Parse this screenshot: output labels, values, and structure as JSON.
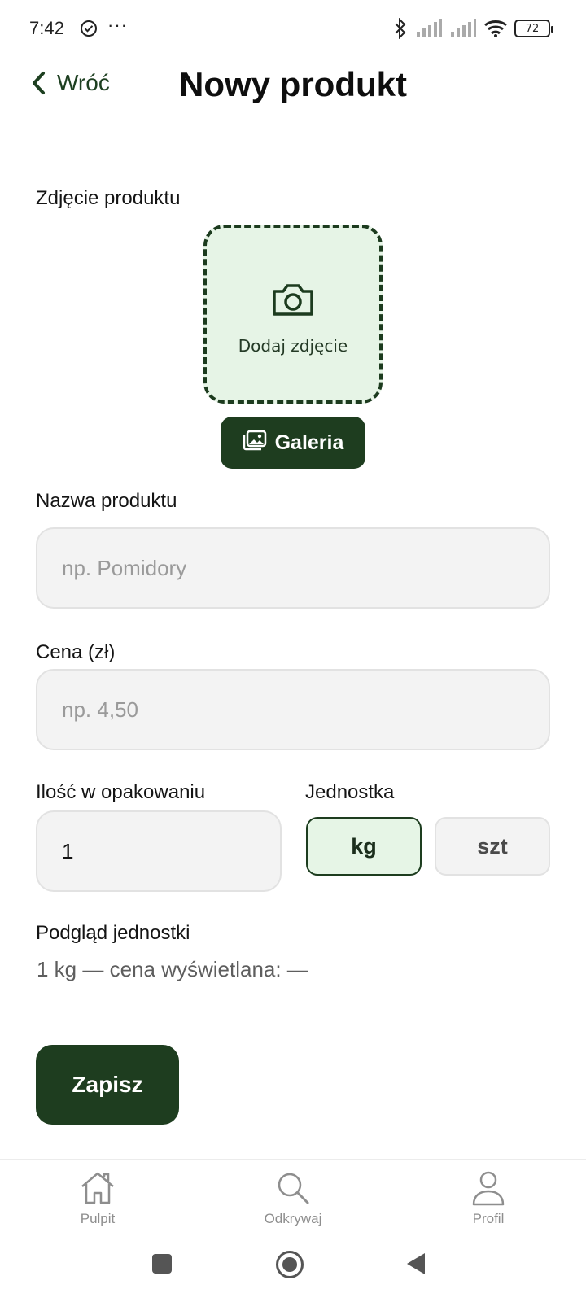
{
  "status_bar": {
    "time": "7:42",
    "dots": "···",
    "battery": "72"
  },
  "header": {
    "back_label": "Wróć",
    "title": "Nowy produkt"
  },
  "photo": {
    "label": "Zdjęcie produktu",
    "add_text": "Dodaj zdjęcie",
    "gallery_label": "Galeria"
  },
  "form": {
    "name_label": "Nazwa produktu",
    "name_placeholder": "np. Pomidory",
    "price_label": "Cena (zł)",
    "price_placeholder": "np. 4,50",
    "quantity_label": "Ilość w opakowaniu",
    "quantity_value": "1",
    "unit_label": "Jednostka",
    "units": [
      {
        "label": "kg",
        "selected": true
      },
      {
        "label": "szt",
        "selected": false
      }
    ],
    "preview_label": "Podgląd jednostki",
    "preview_text": "1 kg — cena wyświetlana: —",
    "save_label": "Zapisz"
  },
  "bottom_nav": {
    "items": [
      {
        "label": "Pulpit",
        "icon": "home-icon"
      },
      {
        "label": "Odkrywaj",
        "icon": "search-icon"
      },
      {
        "label": "Profil",
        "icon": "user-icon"
      }
    ]
  },
  "colors": {
    "primary": "#1e3d1f",
    "selected_bg": "#e6f5e6",
    "input_bg": "#f3f3f3"
  }
}
